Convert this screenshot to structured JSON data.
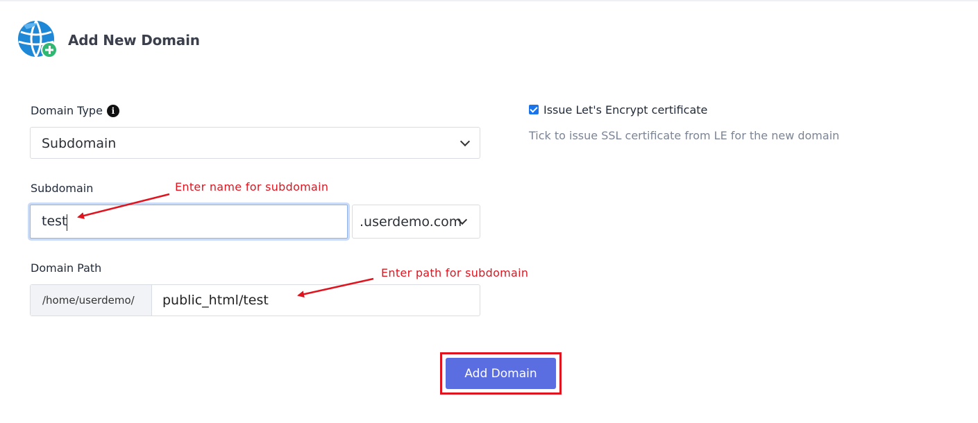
{
  "header": {
    "title": "Add New Domain",
    "icon": "globe-plus-icon"
  },
  "domain_type": {
    "label": "Domain Type",
    "info_icon": "i",
    "selected": "Subdomain"
  },
  "subdomain": {
    "label": "Subdomain",
    "value": "test",
    "suffix": ".userdemo.com"
  },
  "domain_path": {
    "label": "Domain Path",
    "prefix": "/home/userdemo/",
    "value": "public_html/test"
  },
  "ssl": {
    "checked": true,
    "label": "Issue Let's Encrypt certificate",
    "help": "Tick to issue SSL certificate from LE for the new domain"
  },
  "annotations": {
    "subdomain_note": "Enter name for subdomain",
    "path_note": "Enter path for subdomain"
  },
  "submit": {
    "label": "Add Domain"
  },
  "colors": {
    "accent": "#5b6ee1",
    "annotation": "#e0141e",
    "checkbox": "#1a73e8"
  }
}
